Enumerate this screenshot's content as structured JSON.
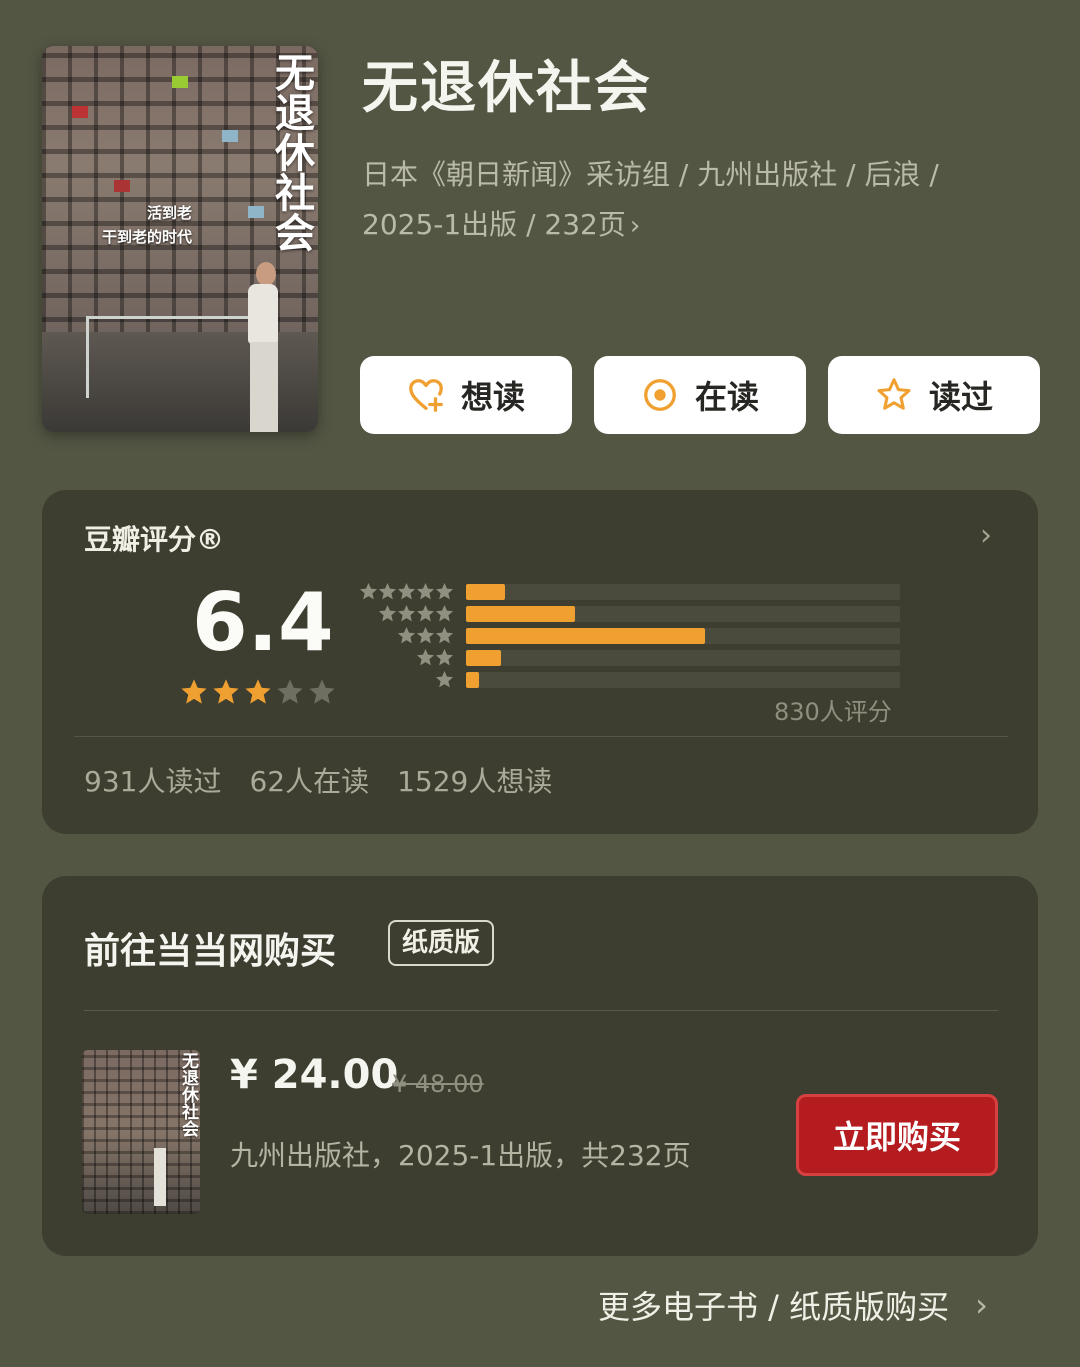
{
  "book": {
    "title": "无退休社会",
    "meta_line1": "日本《朝日新闻》采访组 / 九州出版社 / 后浪 /",
    "meta_line2": "2025-1出版 / 232页",
    "cover": {
      "title": "无退休社会",
      "subtitle1": "活到老",
      "subtitle2": "干到老的时代"
    }
  },
  "actions": {
    "want": "想读",
    "reading": "在读",
    "read": "读过"
  },
  "rating": {
    "label": "豆瓣评分®",
    "score": "6.4",
    "stars_filled": 3,
    "stars_total": 5,
    "distribution": [
      {
        "stars": 5,
        "fraction": 0.09
      },
      {
        "stars": 4,
        "fraction": 0.25
      },
      {
        "stars": 3,
        "fraction": 0.55
      },
      {
        "stars": 2,
        "fraction": 0.08
      },
      {
        "stars": 1,
        "fraction": 0.03
      }
    ],
    "count_text": "830人评分",
    "stats": [
      "931人读过",
      "62人在读",
      "1529人想读"
    ]
  },
  "purchase": {
    "title": "前往当当网购买",
    "edition": "纸质版",
    "price": "¥ 24.00",
    "original_price": "¥ 48.00",
    "meta": "九州出版社，2025-1出版，共232页",
    "buy_label": "立即购买"
  },
  "more_link": "更多电子书 / 纸质版购买",
  "colors": {
    "background": "#545644",
    "card": "#3d3e30",
    "accent_orange": "#f0a030",
    "buy_red": "#b51c1f"
  }
}
